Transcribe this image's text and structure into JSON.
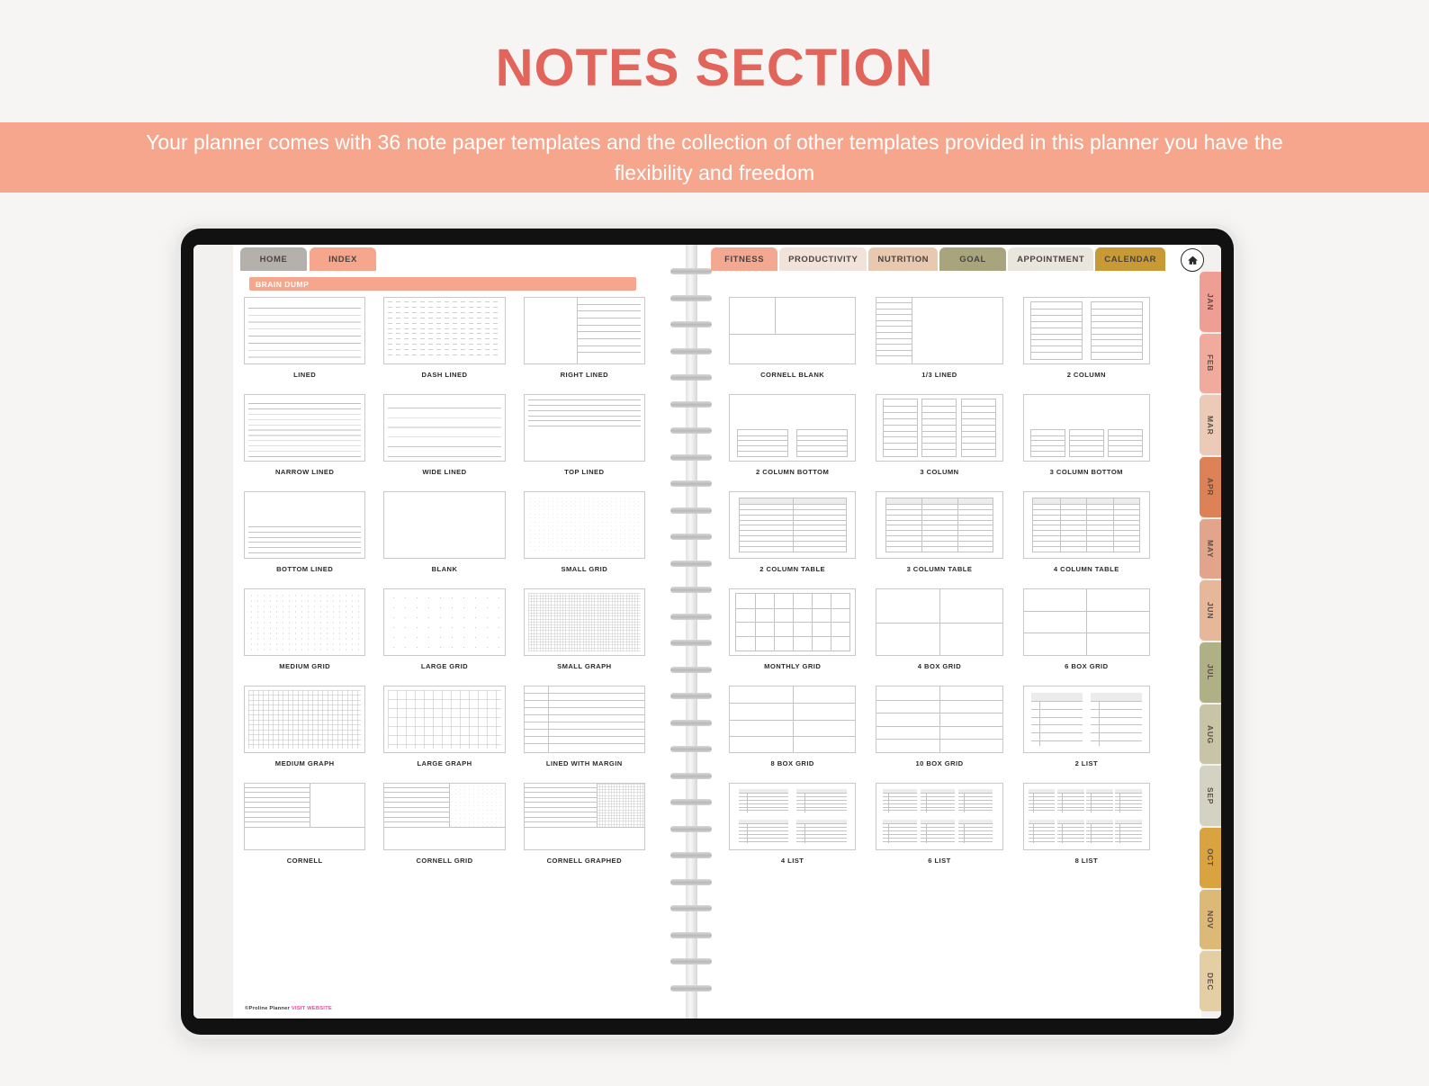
{
  "header": {
    "title": "NOTES SECTION",
    "subtitle": "Your planner comes with 36 note paper templates and the collection of other templates provided in this planner you have the flexibility and freedom",
    "title_color": "#e2655c",
    "band_color": "#f5a68d"
  },
  "top_tabs_left": [
    {
      "label": "HOME",
      "color": "#b4b1ad",
      "active": false
    },
    {
      "label": "INDEX",
      "color": "#f5a68d",
      "active": true
    }
  ],
  "top_tabs_right": [
    {
      "label": "FITNESS",
      "color": "#f3a892"
    },
    {
      "label": "PRODUCTIVITY",
      "color": "#f2e3da"
    },
    {
      "label": "NUTRITION",
      "color": "#e8c8ae"
    },
    {
      "label": "GOAL",
      "color": "#a8a57d"
    },
    {
      "label": "APPOINTMENT",
      "color": "#e9e7dd"
    },
    {
      "label": "CALENDAR",
      "color": "#c79a35"
    }
  ],
  "home_button": {
    "icon": "home-icon"
  },
  "month_tabs": [
    {
      "label": "JAN",
      "color": "#ef9e94"
    },
    {
      "label": "FEB",
      "color": "#f0ab9c"
    },
    {
      "label": "MAR",
      "color": "#ebcbb8"
    },
    {
      "label": "APR",
      "color": "#dd8157"
    },
    {
      "label": "MAY",
      "color": "#e2a58c"
    },
    {
      "label": "JUN",
      "color": "#e7b79a"
    },
    {
      "label": "JUL",
      "color": "#b0b087"
    },
    {
      "label": "AUG",
      "color": "#c7c5a6"
    },
    {
      "label": "SEP",
      "color": "#d3d2c3"
    },
    {
      "label": "OCT",
      "color": "#d9a33f"
    },
    {
      "label": "NOV",
      "color": "#ddb978"
    },
    {
      "label": "DEC",
      "color": "#e4cfa4"
    }
  ],
  "section": {
    "label": "BRAIN DUMP"
  },
  "left_page_templates": [
    {
      "label": "LINED",
      "style": "lined"
    },
    {
      "label": "DASH LINED",
      "style": "dash-lined"
    },
    {
      "label": "RIGHT LINED",
      "style": "right-lined"
    },
    {
      "label": "NARROW LINED",
      "style": "narrow-lined"
    },
    {
      "label": "WIDE LINED",
      "style": "wide-lined"
    },
    {
      "label": "TOP LINED",
      "style": "top-lined"
    },
    {
      "label": "BOTTOM LINED",
      "style": "bottom-lined"
    },
    {
      "label": "BLANK",
      "style": "blank"
    },
    {
      "label": "SMALL GRID",
      "style": "small-grid"
    },
    {
      "label": "MEDIUM GRID",
      "style": "medium-grid"
    },
    {
      "label": "LARGE GRID",
      "style": "large-grid"
    },
    {
      "label": "SMALL GRAPH",
      "style": "small-graph"
    },
    {
      "label": "MEDIUM GRAPH",
      "style": "medium-graph"
    },
    {
      "label": "LARGE GRAPH",
      "style": "large-graph"
    },
    {
      "label": "LINED WITH MARGIN",
      "style": "lined-margin"
    },
    {
      "label": "CORNELL",
      "style": "cornell"
    },
    {
      "label": "CORNELL GRID",
      "style": "cornell-grid"
    },
    {
      "label": "CORNELL GRAPHED",
      "style": "cornell-graphed"
    }
  ],
  "right_page_templates": [
    {
      "label": "CORNELL BLANK",
      "style": "cornell-blank"
    },
    {
      "label": "1/3 LINED",
      "style": "third-lined"
    },
    {
      "label": "2 COLUMN",
      "style": "col2"
    },
    {
      "label": "2 COLUMN BOTTOM",
      "style": "col2-bottom"
    },
    {
      "label": "3 COLUMN",
      "style": "col3"
    },
    {
      "label": "3 COLUMN BOTTOM",
      "style": "col3-bottom"
    },
    {
      "label": "2 COLUMN TABLE",
      "style": "table2"
    },
    {
      "label": "3 COLUMN TABLE",
      "style": "table3"
    },
    {
      "label": "4 COLUMN TABLE",
      "style": "table4"
    },
    {
      "label": "MONTHLY GRID",
      "style": "monthly-grid"
    },
    {
      "label": "4 BOX GRID",
      "style": "box4"
    },
    {
      "label": "6 BOX GRID",
      "style": "box6"
    },
    {
      "label": "8 BOX GRID",
      "style": "box8"
    },
    {
      "label": "10 BOX GRID",
      "style": "box10"
    },
    {
      "label": "2 LIST",
      "style": "list2"
    },
    {
      "label": "4 LIST",
      "style": "list4"
    },
    {
      "label": "6 LIST",
      "style": "list6"
    },
    {
      "label": "8 LIST",
      "style": "list8"
    }
  ],
  "footer": {
    "copyright": "©Proline Planner ",
    "link": "VISIT WEBSITE"
  }
}
